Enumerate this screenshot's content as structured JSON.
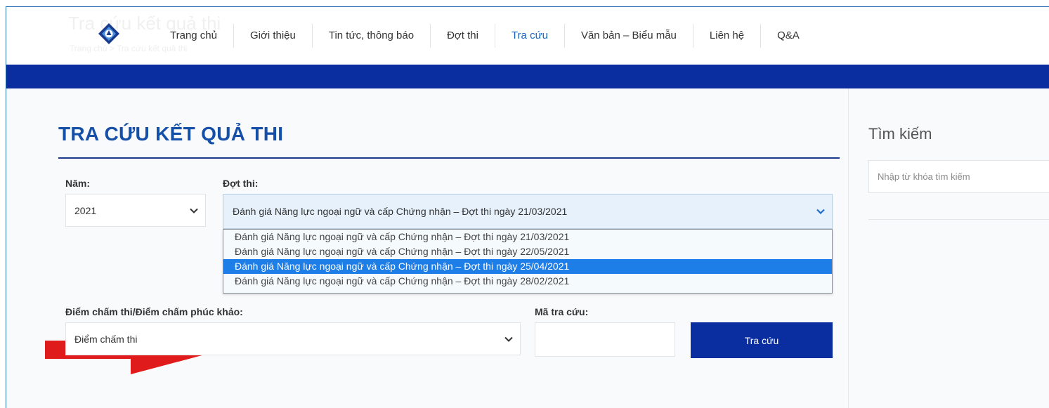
{
  "header": {
    "ghost_title": "Tra cứu kết quả thi",
    "ghost_breadcrumb": "Trang chủ  >  Tra cứu kết quả thi",
    "nav": [
      {
        "label": "Trang chủ",
        "active": false
      },
      {
        "label": "Giới thiệu",
        "active": false
      },
      {
        "label": "Tin tức, thông báo",
        "active": false
      },
      {
        "label": "Đợt thi",
        "active": false
      },
      {
        "label": "Tra cứu",
        "active": true
      },
      {
        "label": "Văn bản – Biểu mẫu",
        "active": false
      },
      {
        "label": "Liên hệ",
        "active": false
      },
      {
        "label": "Q&A",
        "active": false
      }
    ]
  },
  "main": {
    "title": "TRA CỨU KẾT QUẢ THI",
    "year": {
      "label": "Năm:",
      "value": "2021"
    },
    "exam_round": {
      "label": "Đợt thi:",
      "value": "Đánh giá Năng lực ngoại ngữ và cấp Chứng nhận – Đợt thi ngày 21/03/2021",
      "options": [
        "Đánh giá Năng lực ngoại ngữ và cấp Chứng nhận – Đợt thi ngày 21/03/2021",
        "Đánh giá Năng lực ngoại ngữ và cấp Chứng nhận – Đợt thi ngày 22/05/2021",
        "Đánh giá Năng lực ngoại ngữ và cấp Chứng nhận – Đợt thi ngày 25/04/2021",
        "Đánh giá Năng lực ngoại ngữ và cấp Chứng nhận – Đợt thi ngày 28/02/2021"
      ],
      "highlighted_index": 2
    },
    "score_type": {
      "label": "Điểm chấm thi/Điểm chấm phúc khảo:",
      "value": "Điểm chấm thi"
    },
    "lookup_code": {
      "label": "Mã tra cứu:",
      "value": ""
    },
    "submit_label": "Tra cứu"
  },
  "sidebar": {
    "title": "Tìm kiếm",
    "search_placeholder": "Nhập từ khóa tìm kiếm"
  },
  "colors": {
    "brand_blue": "#0a2ea0",
    "title_blue": "#1550a8",
    "highlight": "#1e7ee8",
    "arrow_red": "#e01b1b"
  }
}
